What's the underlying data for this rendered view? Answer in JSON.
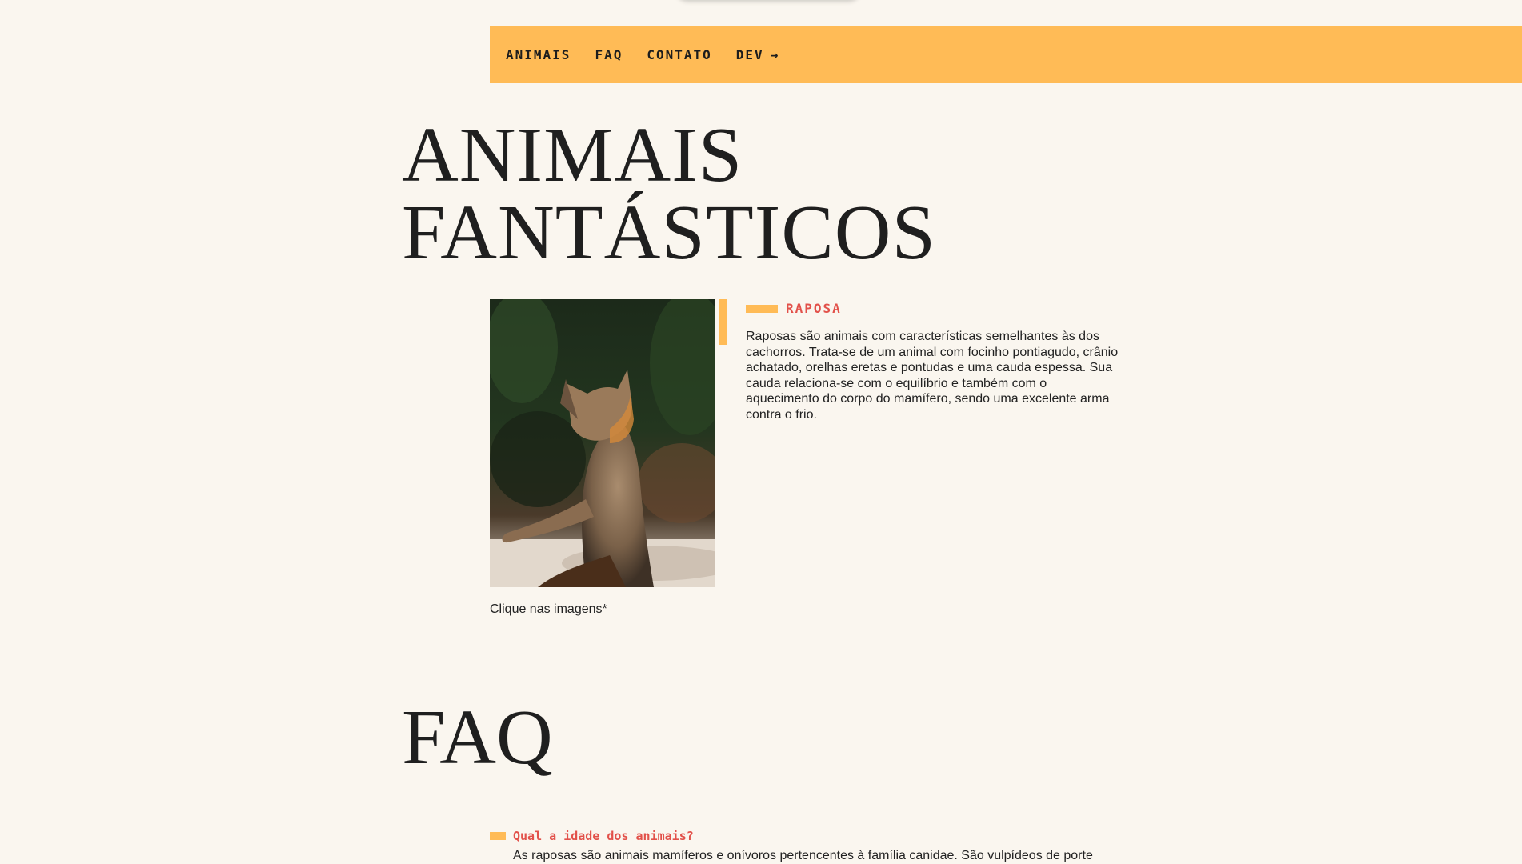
{
  "nav": {
    "items": [
      {
        "label": "ANIMAIS"
      },
      {
        "label": "FAQ"
      },
      {
        "label": "CONTATO"
      },
      {
        "label": "DEV",
        "icon": "arrow-right-icon",
        "arrow": "→"
      }
    ]
  },
  "hero": {
    "title_line1": "ANIMAIS",
    "title_line2": "FANTÁSTICOS"
  },
  "animal": {
    "name": "RAPOSA",
    "image_alt": "fox-photo",
    "description": "Raposas são animais com características semelhantes às dos cachorros. Trata-se de um animal com focinho pontiagudo, crânio achatado, orelhas eretas e pontudas e uma cauda espessa. Sua cauda relaciona-se com o equilíbrio e também com o aquecimento do corpo do mamífero, sendo uma excelente arma contra o frio."
  },
  "caption": "Clique nas imagens*",
  "faq": {
    "title": "FAQ",
    "items": [
      {
        "question": "Qual a idade dos animais?",
        "answer": "As raposas são animais mamíferos e onívoros pertencentes à família canidae. São vulpídeos de porte"
      }
    ]
  },
  "colors": {
    "background": "#faf6ef",
    "accent": "#ffbb56",
    "highlight": "#e2514a",
    "text": "#222222"
  }
}
